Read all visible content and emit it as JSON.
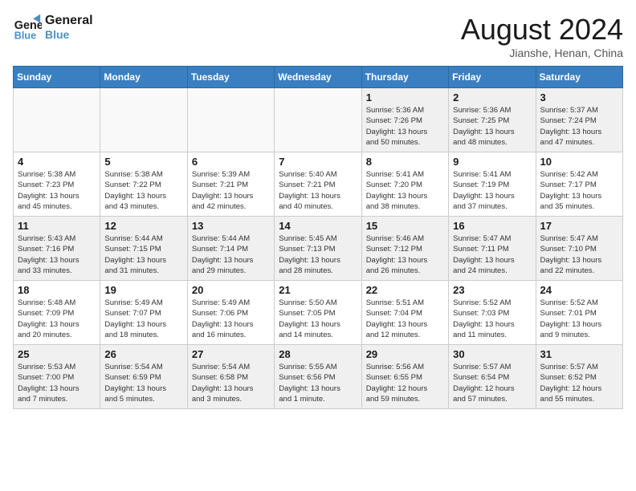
{
  "logo": {
    "line1": "General",
    "line2": "Blue"
  },
  "title": "August 2024",
  "location": "Jianshe, Henan, China",
  "weekdays": [
    "Sunday",
    "Monday",
    "Tuesday",
    "Wednesday",
    "Thursday",
    "Friday",
    "Saturday"
  ],
  "weeks": [
    [
      {
        "day": "",
        "info": ""
      },
      {
        "day": "",
        "info": ""
      },
      {
        "day": "",
        "info": ""
      },
      {
        "day": "",
        "info": ""
      },
      {
        "day": "1",
        "info": "Sunrise: 5:36 AM\nSunset: 7:26 PM\nDaylight: 13 hours\nand 50 minutes."
      },
      {
        "day": "2",
        "info": "Sunrise: 5:36 AM\nSunset: 7:25 PM\nDaylight: 13 hours\nand 48 minutes."
      },
      {
        "day": "3",
        "info": "Sunrise: 5:37 AM\nSunset: 7:24 PM\nDaylight: 13 hours\nand 47 minutes."
      }
    ],
    [
      {
        "day": "4",
        "info": "Sunrise: 5:38 AM\nSunset: 7:23 PM\nDaylight: 13 hours\nand 45 minutes."
      },
      {
        "day": "5",
        "info": "Sunrise: 5:38 AM\nSunset: 7:22 PM\nDaylight: 13 hours\nand 43 minutes."
      },
      {
        "day": "6",
        "info": "Sunrise: 5:39 AM\nSunset: 7:21 PM\nDaylight: 13 hours\nand 42 minutes."
      },
      {
        "day": "7",
        "info": "Sunrise: 5:40 AM\nSunset: 7:21 PM\nDaylight: 13 hours\nand 40 minutes."
      },
      {
        "day": "8",
        "info": "Sunrise: 5:41 AM\nSunset: 7:20 PM\nDaylight: 13 hours\nand 38 minutes."
      },
      {
        "day": "9",
        "info": "Sunrise: 5:41 AM\nSunset: 7:19 PM\nDaylight: 13 hours\nand 37 minutes."
      },
      {
        "day": "10",
        "info": "Sunrise: 5:42 AM\nSunset: 7:17 PM\nDaylight: 13 hours\nand 35 minutes."
      }
    ],
    [
      {
        "day": "11",
        "info": "Sunrise: 5:43 AM\nSunset: 7:16 PM\nDaylight: 13 hours\nand 33 minutes."
      },
      {
        "day": "12",
        "info": "Sunrise: 5:44 AM\nSunset: 7:15 PM\nDaylight: 13 hours\nand 31 minutes."
      },
      {
        "day": "13",
        "info": "Sunrise: 5:44 AM\nSunset: 7:14 PM\nDaylight: 13 hours\nand 29 minutes."
      },
      {
        "day": "14",
        "info": "Sunrise: 5:45 AM\nSunset: 7:13 PM\nDaylight: 13 hours\nand 28 minutes."
      },
      {
        "day": "15",
        "info": "Sunrise: 5:46 AM\nSunset: 7:12 PM\nDaylight: 13 hours\nand 26 minutes."
      },
      {
        "day": "16",
        "info": "Sunrise: 5:47 AM\nSunset: 7:11 PM\nDaylight: 13 hours\nand 24 minutes."
      },
      {
        "day": "17",
        "info": "Sunrise: 5:47 AM\nSunset: 7:10 PM\nDaylight: 13 hours\nand 22 minutes."
      }
    ],
    [
      {
        "day": "18",
        "info": "Sunrise: 5:48 AM\nSunset: 7:09 PM\nDaylight: 13 hours\nand 20 minutes."
      },
      {
        "day": "19",
        "info": "Sunrise: 5:49 AM\nSunset: 7:07 PM\nDaylight: 13 hours\nand 18 minutes."
      },
      {
        "day": "20",
        "info": "Sunrise: 5:49 AM\nSunset: 7:06 PM\nDaylight: 13 hours\nand 16 minutes."
      },
      {
        "day": "21",
        "info": "Sunrise: 5:50 AM\nSunset: 7:05 PM\nDaylight: 13 hours\nand 14 minutes."
      },
      {
        "day": "22",
        "info": "Sunrise: 5:51 AM\nSunset: 7:04 PM\nDaylight: 13 hours\nand 12 minutes."
      },
      {
        "day": "23",
        "info": "Sunrise: 5:52 AM\nSunset: 7:03 PM\nDaylight: 13 hours\nand 11 minutes."
      },
      {
        "day": "24",
        "info": "Sunrise: 5:52 AM\nSunset: 7:01 PM\nDaylight: 13 hours\nand 9 minutes."
      }
    ],
    [
      {
        "day": "25",
        "info": "Sunrise: 5:53 AM\nSunset: 7:00 PM\nDaylight: 13 hours\nand 7 minutes."
      },
      {
        "day": "26",
        "info": "Sunrise: 5:54 AM\nSunset: 6:59 PM\nDaylight: 13 hours\nand 5 minutes."
      },
      {
        "day": "27",
        "info": "Sunrise: 5:54 AM\nSunset: 6:58 PM\nDaylight: 13 hours\nand 3 minutes."
      },
      {
        "day": "28",
        "info": "Sunrise: 5:55 AM\nSunset: 6:56 PM\nDaylight: 13 hours\nand 1 minute."
      },
      {
        "day": "29",
        "info": "Sunrise: 5:56 AM\nSunset: 6:55 PM\nDaylight: 12 hours\nand 59 minutes."
      },
      {
        "day": "30",
        "info": "Sunrise: 5:57 AM\nSunset: 6:54 PM\nDaylight: 12 hours\nand 57 minutes."
      },
      {
        "day": "31",
        "info": "Sunrise: 5:57 AM\nSunset: 6:52 PM\nDaylight: 12 hours\nand 55 minutes."
      }
    ]
  ]
}
